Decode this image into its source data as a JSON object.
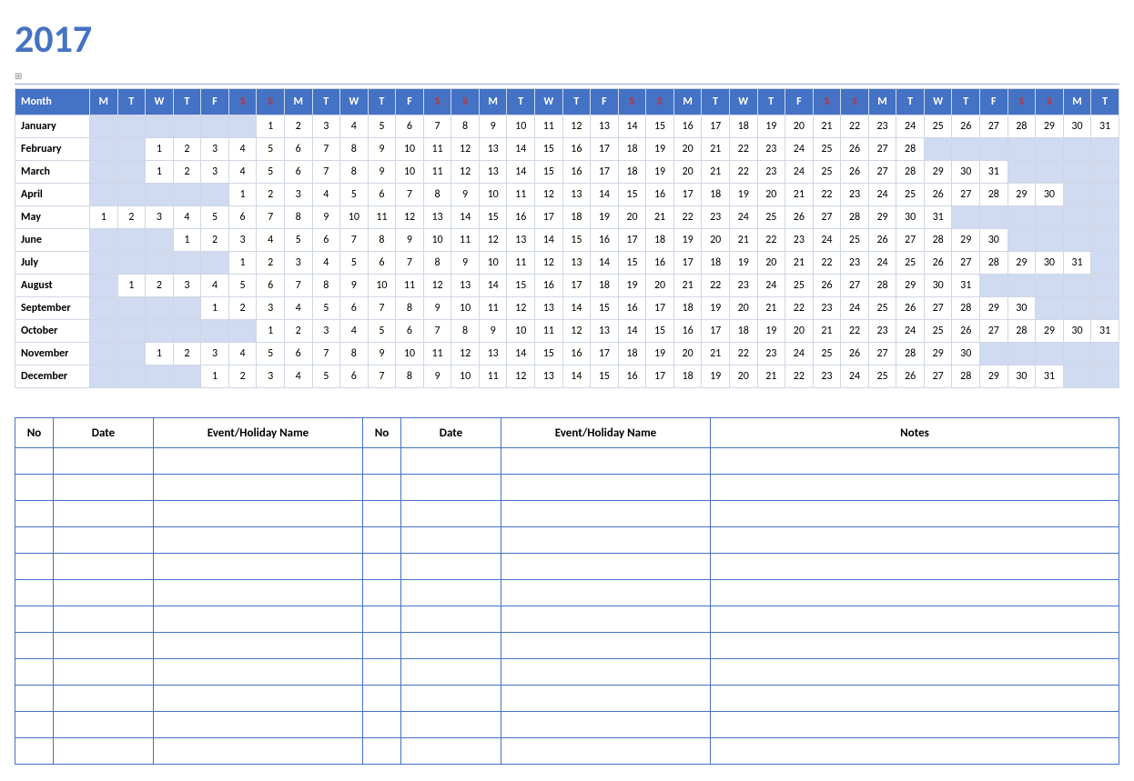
{
  "year": "2017",
  "calendar": {
    "monthHeader": "Month",
    "dayHeaders": [
      {
        "label": "M",
        "weekend": false
      },
      {
        "label": "T",
        "weekend": false
      },
      {
        "label": "W",
        "weekend": false
      },
      {
        "label": "T",
        "weekend": false
      },
      {
        "label": "F",
        "weekend": false
      },
      {
        "label": "S",
        "weekend": true
      },
      {
        "label": "S",
        "weekend": true
      },
      {
        "label": "M",
        "weekend": false
      },
      {
        "label": "T",
        "weekend": false
      },
      {
        "label": "W",
        "weekend": false
      },
      {
        "label": "T",
        "weekend": false
      },
      {
        "label": "F",
        "weekend": false
      },
      {
        "label": "S",
        "weekend": true
      },
      {
        "label": "S",
        "weekend": true
      },
      {
        "label": "M",
        "weekend": false
      },
      {
        "label": "T",
        "weekend": false
      },
      {
        "label": "W",
        "weekend": false
      },
      {
        "label": "T",
        "weekend": false
      },
      {
        "label": "F",
        "weekend": false
      },
      {
        "label": "S",
        "weekend": true
      },
      {
        "label": "S",
        "weekend": true
      },
      {
        "label": "M",
        "weekend": false
      },
      {
        "label": "T",
        "weekend": false
      },
      {
        "label": "W",
        "weekend": false
      },
      {
        "label": "T",
        "weekend": false
      },
      {
        "label": "F",
        "weekend": false
      },
      {
        "label": "S",
        "weekend": true
      },
      {
        "label": "S",
        "weekend": true
      },
      {
        "label": "M",
        "weekend": false
      },
      {
        "label": "T",
        "weekend": false
      },
      {
        "label": "W",
        "weekend": false
      },
      {
        "label": "T",
        "weekend": false
      },
      {
        "label": "F",
        "weekend": false
      },
      {
        "label": "S",
        "weekend": true
      },
      {
        "label": "S",
        "weekend": true
      },
      {
        "label": "M",
        "weekend": false
      },
      {
        "label": "T",
        "weekend": false
      }
    ],
    "months": [
      {
        "name": "January",
        "offset": 6,
        "days": 31
      },
      {
        "name": "February",
        "offset": 2,
        "days": 28
      },
      {
        "name": "March",
        "offset": 2,
        "days": 31
      },
      {
        "name": "April",
        "offset": 5,
        "days": 30
      },
      {
        "name": "May",
        "offset": 0,
        "days": 31
      },
      {
        "name": "June",
        "offset": 3,
        "days": 30
      },
      {
        "name": "July",
        "offset": 5,
        "days": 31
      },
      {
        "name": "August",
        "offset": 1,
        "days": 31
      },
      {
        "name": "September",
        "offset": 4,
        "days": 30
      },
      {
        "name": "October",
        "offset": 6,
        "days": 31
      },
      {
        "name": "November",
        "offset": 2,
        "days": 30
      },
      {
        "name": "December",
        "offset": 4,
        "days": 31
      }
    ],
    "totalColumns": 37
  },
  "events": {
    "headers": {
      "no": "No",
      "date": "Date",
      "event": "Event/Holiday Name",
      "notes": "Notes"
    },
    "rowCount": 12
  }
}
